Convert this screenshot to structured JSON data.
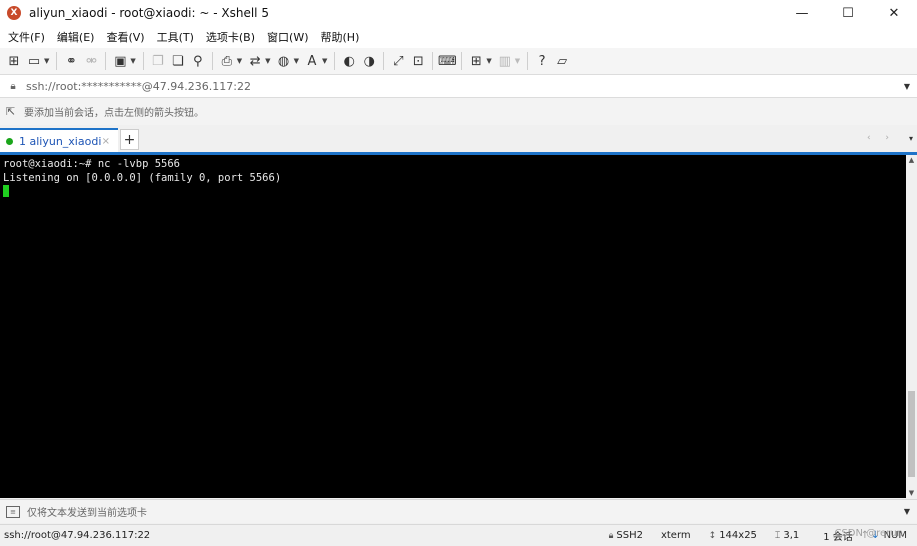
{
  "window": {
    "title": "aliyun_xiaodi - root@xiaodi: ~ - Xshell 5",
    "minimize": "—",
    "maximize": "☐",
    "close": "✕"
  },
  "menu": [
    "文件(F)",
    "编辑(E)",
    "查看(V)",
    "工具(T)",
    "选项卡(B)",
    "窗口(W)",
    "帮助(H)"
  ],
  "toolbar": {
    "icons": [
      "new-session-icon",
      "open-folder-icon",
      "reconnect-icon",
      "disconnect-icon",
      "properties-icon",
      "copy-icon",
      "paste-icon",
      "find-icon",
      "print-icon",
      "transfer-icon",
      "globe-icon",
      "font-icon",
      "xftp-icon",
      "xshell-icon",
      "fullscreen-icon",
      "lock-icon",
      "keyboard-icon",
      "compose-add-icon",
      "layout-icon",
      "help-icon",
      "chat-icon"
    ]
  },
  "address": {
    "value": "ssh://root:***********@47.94.236.117:22"
  },
  "hint": {
    "text": "要添加当前会话，点击左侧的箭头按钮。"
  },
  "tabs": {
    "active_label": "1 aliyun_xiaodi",
    "close": "×",
    "new_tab": "+",
    "nav": "‹ ›",
    "menu": "▾"
  },
  "terminal": {
    "line1": "root@xiaodi:~# nc -lvbp 5566",
    "line2": "Listening on [0.0.0.0] (family 0, port 5566)"
  },
  "compose": {
    "text": "仅将文本发送到当前选项卡"
  },
  "status": {
    "connection": "ssh://root@47.94.236.117:22",
    "protocol": "SSH2",
    "terminal_type": "xterm",
    "size": "144x25",
    "cursor_pos": "3,1",
    "sessions": "1 会话",
    "numlock": "NUM",
    "watermark": "CSDN @rerun"
  }
}
